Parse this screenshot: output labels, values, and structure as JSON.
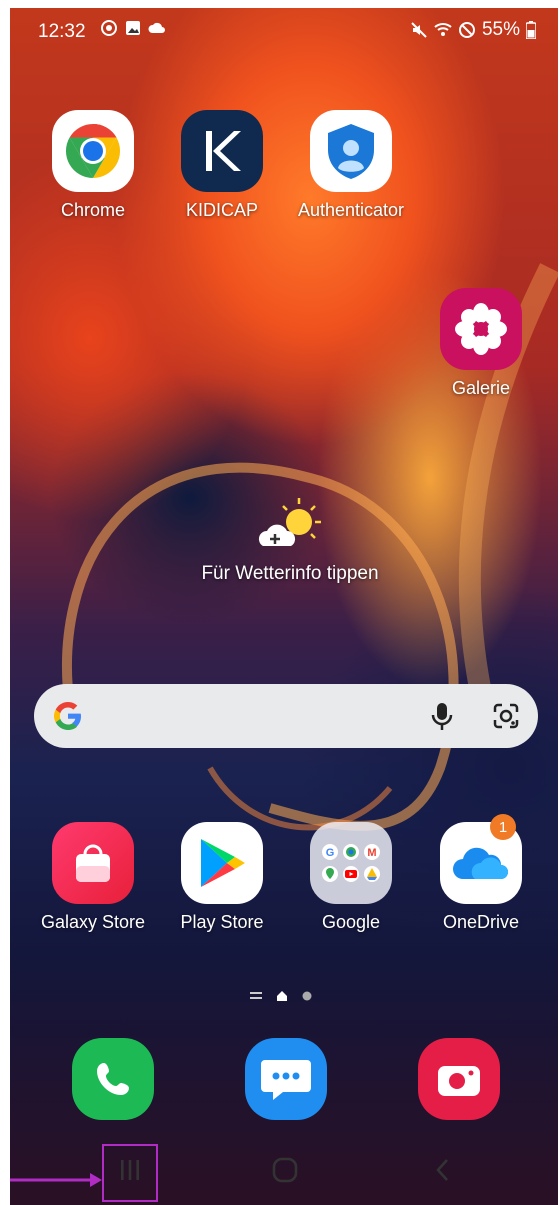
{
  "status": {
    "time": "12:32",
    "battery": "55%",
    "left_icons": [
      "screen-recorder-icon",
      "gallery-notification-icon",
      "weather-notification-icon"
    ],
    "right_icons": [
      "mute-icon",
      "wifi-icon",
      "no-disturb-icon",
      "battery-icon"
    ]
  },
  "apps_top": [
    {
      "label": "Chrome",
      "icon": "chrome-icon"
    },
    {
      "label": "KIDICAP",
      "icon": "kidicap-icon"
    },
    {
      "label": "Authenticator",
      "icon": "authenticator-icon"
    }
  ],
  "app_gallery": {
    "label": "Galerie",
    "icon": "galerie-icon"
  },
  "weather": {
    "text": "Für Wetterinfo tippen",
    "icon": "weather-sun-cloud-icon"
  },
  "search": {
    "logo": "google-g-icon",
    "mic": "mic-icon",
    "lens": "google-lens-icon"
  },
  "apps_row": [
    {
      "label": "Galaxy Store",
      "icon": "galaxy-store-icon"
    },
    {
      "label": "Play Store",
      "icon": "play-store-icon"
    },
    {
      "label": "Google",
      "icon": "google-folder-icon"
    },
    {
      "label": "OneDrive",
      "icon": "onedrive-icon",
      "badge": "1"
    }
  ],
  "dock": [
    {
      "icon": "phone-icon"
    },
    {
      "icon": "messages-icon"
    },
    {
      "icon": "camera-icon"
    }
  ],
  "nav": {
    "recents": "recents-icon",
    "home": "home-icon",
    "back": "back-icon"
  },
  "colors": {
    "highlight": "#b12cc4",
    "badge": "#f07a26",
    "galerie": "#c9115f",
    "phone": "#1db954",
    "messages": "#1f8ef0",
    "camera": "#e41e47"
  }
}
